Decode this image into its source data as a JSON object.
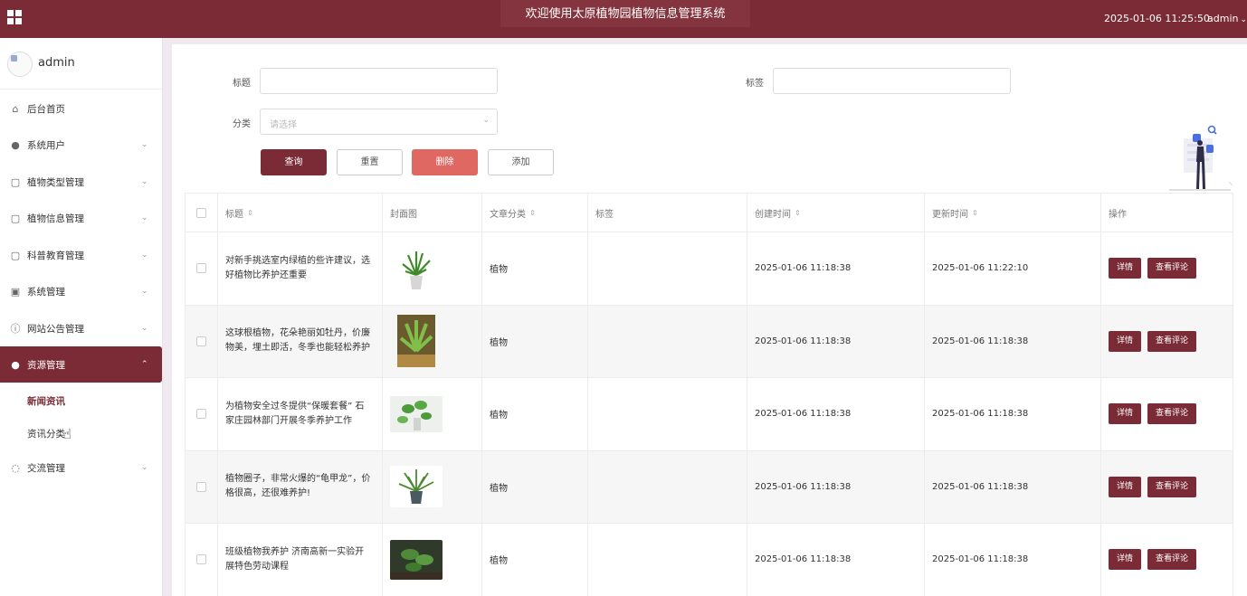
{
  "header": {
    "title": "欢迎使用太原植物园植物信息管理系统",
    "datetime": "2025-01-06 11:25:50",
    "user": "admin"
  },
  "sidebar": {
    "username": "admin",
    "items": [
      {
        "label": "后台首页",
        "icon": "home-icon"
      },
      {
        "label": "系统用户",
        "icon": "user-icon"
      },
      {
        "label": "植物类型管理",
        "icon": "doc-icon"
      },
      {
        "label": "植物信息管理",
        "icon": "doc-icon"
      },
      {
        "label": "科普教育管理",
        "icon": "doc-icon"
      },
      {
        "label": "系统管理",
        "icon": "image-icon"
      },
      {
        "label": "网站公告管理",
        "icon": "info-icon"
      },
      {
        "label": "资源管理",
        "icon": "bulb-icon"
      },
      {
        "label": "交流管理",
        "icon": "chat-icon"
      }
    ],
    "subitems": [
      {
        "label": "新闻资讯"
      },
      {
        "label": "资讯分类"
      }
    ]
  },
  "search": {
    "title_label": "标题",
    "tag_label": "标签",
    "category_label": "分类",
    "category_placeholder": "请选择",
    "title_value": "",
    "tag_value": ""
  },
  "buttons": {
    "query": "查询",
    "reset": "重置",
    "delete": "删除",
    "add": "添加"
  },
  "table": {
    "headers": {
      "title": "标题",
      "cover": "封面图",
      "category": "文章分类",
      "tags": "标签",
      "created": "创建时间",
      "updated": "更新时间",
      "actions": "操作"
    },
    "rows": [
      {
        "title": "对新手挑选室内绿植的些许建议，选好植物比养护还重要",
        "category": "植物",
        "tags": "",
        "created": "2025-01-06 11:18:38",
        "updated": "2025-01-06 11:22:10"
      },
      {
        "title": "这球根植物，花朵艳丽如牡丹，价廉物美，埋土即活，冬季也能轻松养护",
        "category": "植物",
        "tags": "",
        "created": "2025-01-06 11:18:38",
        "updated": "2025-01-06 11:18:38"
      },
      {
        "title": "为植物安全过冬提供“保暖套餐” 石家庄园林部门开展冬季养护工作",
        "category": "植物",
        "tags": "",
        "created": "2025-01-06 11:18:38",
        "updated": "2025-01-06 11:18:38"
      },
      {
        "title": "植物圈子，非常火爆的“龟甲龙”，价格很高，还很难养护!",
        "category": "植物",
        "tags": "",
        "created": "2025-01-06 11:18:38",
        "updated": "2025-01-06 11:18:38"
      },
      {
        "title": "班级植物我养护 济南高新一实验开展特色劳动课程",
        "category": "植物",
        "tags": "",
        "created": "2025-01-06 11:18:38",
        "updated": "2025-01-06 11:18:38"
      }
    ],
    "detail_label": "详情",
    "comments_label": "查看评论"
  },
  "colors": {
    "primary": "#7a2b35",
    "danger": "#e06863"
  }
}
